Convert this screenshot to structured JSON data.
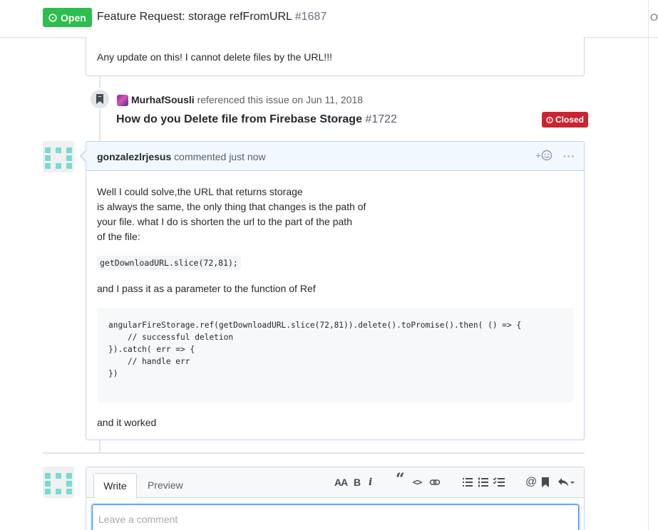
{
  "header": {
    "state": "Open",
    "title": "Feature Request: storage refFromURL",
    "number": "#1687",
    "edge_letter": "O"
  },
  "prev_comment": {
    "text": "Any update on this! I cannot delete files by the URL!!!"
  },
  "reference_event": {
    "user": "MurhafSousli",
    "action": "referenced this issue on Jun 11, 2018",
    "title": "How do you Delete file from Firebase Storage",
    "number": "#1722",
    "state": "Closed"
  },
  "comment": {
    "author": "gonzalezlrjesus",
    "action": "commented just now",
    "reaction_plus": "+",
    "more": "···",
    "body_lines": [
      "Well I could solve,the URL that returns storage",
      "is always the same, the only thing that changes is the path of",
      "your file. what I do is shorten the url to the part of the path",
      "of the file:"
    ],
    "inline_code": "getDownloadURL.slice(72,81);",
    "para2": "and I pass it as a parameter to the function of Ref",
    "code_block": "angularFireStorage.ref(getDownloadURL.slice(72,81)).delete().toPromise().then( () => {\n    // successful deletion\n}).catch( err => {\n    // handle err\n})",
    "para3": "and it worked"
  },
  "new_comment": {
    "tab_write": "Write",
    "tab_preview": "Preview",
    "toolbar": {
      "heading": "AA",
      "bold": "B",
      "italic": "i",
      "quote": "“",
      "code": "<>",
      "mention": "@"
    },
    "placeholder": "Leave a comment"
  },
  "colors": {
    "open_green": "#2cbe4e",
    "closed_red": "#cb2431",
    "comment_header_bg": "#f1f8ff",
    "identicon": "#78dbd3"
  }
}
